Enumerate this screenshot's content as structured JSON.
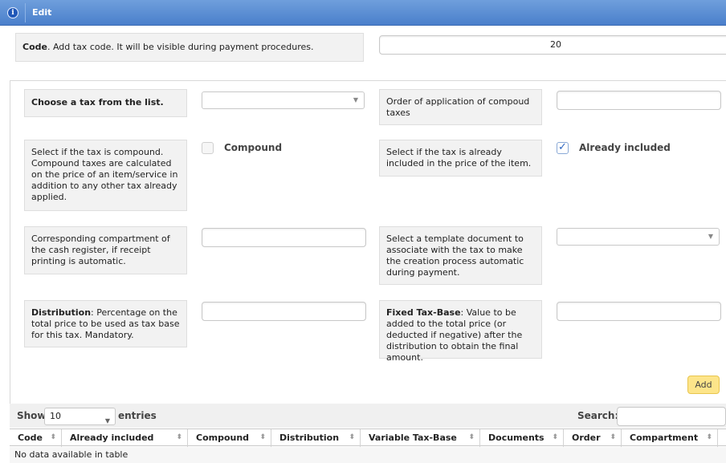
{
  "window": {
    "title": "Edit"
  },
  "code": {
    "label_bold": "Code",
    "label_rest": ". Add tax code. It will be visible during payment procedures.",
    "value": "20"
  },
  "form": {
    "tax_choice_label": "Choose a tax from the list.",
    "tax_choice_value": "",
    "order_label": "Order of application of compoud taxes",
    "order_value": "",
    "compound_desc": "Select if the tax is compound. Compound taxes are calculated on the price of an item/service in addition to any other tax already applied.",
    "compound_label": "Compound",
    "compound_checked": false,
    "included_desc": "Select if the tax is already included in the price of the item.",
    "included_label": "Already included",
    "included_checked": true,
    "compartment_label": "Corresponding compartment of the cash register, if receipt printing is automatic.",
    "compartment_value": "",
    "template_label": "Select a template document to associate with the tax to make the creation process automatic during payment.",
    "template_value": "",
    "distribution_label_bold": "Distribution",
    "distribution_label_rest": ": Percentage on the total price to be used as tax base for this tax. Mandatory.",
    "distribution_value": "",
    "fixed_label_bold": "Fixed Tax-Base",
    "fixed_label_rest": ": Value to be added to the total price (or deducted if negative) after the distribution to obtain the final amount.",
    "fixed_value": "",
    "add_button": "Add"
  },
  "table": {
    "show_label": "Show",
    "entries_value": "10",
    "entries_label": "entries",
    "search_label": "Search:",
    "search_value": "",
    "columns": [
      "Code",
      "Already included",
      "Compound",
      "Distribution",
      "Variable Tax-Base",
      "Documents",
      "Order",
      "Compartment"
    ],
    "empty_message": "No data available in table"
  },
  "icons": {
    "info": "info-icon",
    "sort": "sort-icon",
    "caret": "chevron-down-icon",
    "check": "checkmark-icon"
  },
  "colors": {
    "titlebar": "#5a8fd6",
    "add_button": "#fde58a",
    "checkbox_accent": "#2f66c0"
  }
}
